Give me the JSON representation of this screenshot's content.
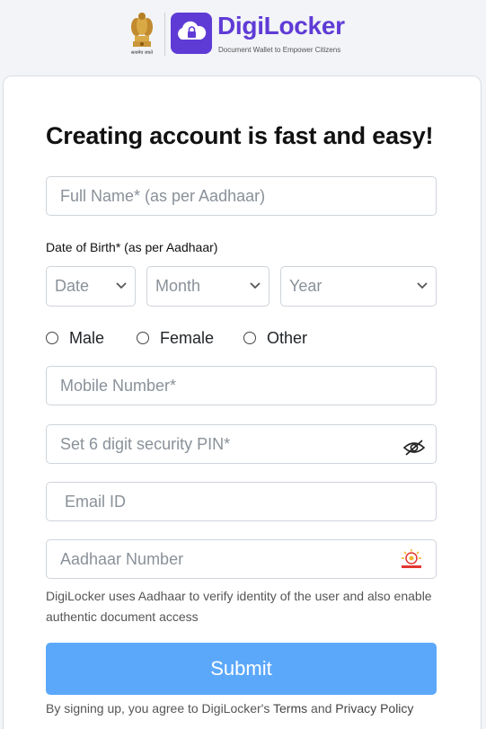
{
  "header": {
    "emblem_caption": "सत्यमेव जयते",
    "brand_name": "DigiLocker",
    "brand_tagline": "Document Wallet to Empower Citizens",
    "brand_color": "#5f3bd6"
  },
  "form": {
    "title": "Creating account is fast and easy!",
    "full_name_placeholder": "Full Name* (as per Aadhaar)",
    "dob_label": "Date of Birth* (as per Aadhaar)",
    "date_select": "Date",
    "month_select": "Month",
    "year_select": "Year",
    "gender_options": [
      "Male",
      "Female",
      "Other"
    ],
    "mobile_placeholder": "Mobile Number*",
    "pin_placeholder": "Set 6 digit security PIN*",
    "email_placeholder": "Email ID",
    "aadhaar_placeholder": "Aadhaar Number",
    "aadhaar_helper": "DigiLocker uses Aadhaar to verify identity of the user and also enable authentic document access",
    "submit_label": "Submit",
    "submit_color": "#5ba8fb",
    "terms_prefix": "By signing up, you agree to DigiLocker's ",
    "terms_link": "Terms",
    "terms_and": " and ",
    "privacy_link": "Privacy Policy"
  },
  "icons": {
    "pin_toggle": "eye-slash-icon",
    "aadhaar": "aadhaar-logo-icon",
    "select_arrow": "chevron-down-icon"
  }
}
